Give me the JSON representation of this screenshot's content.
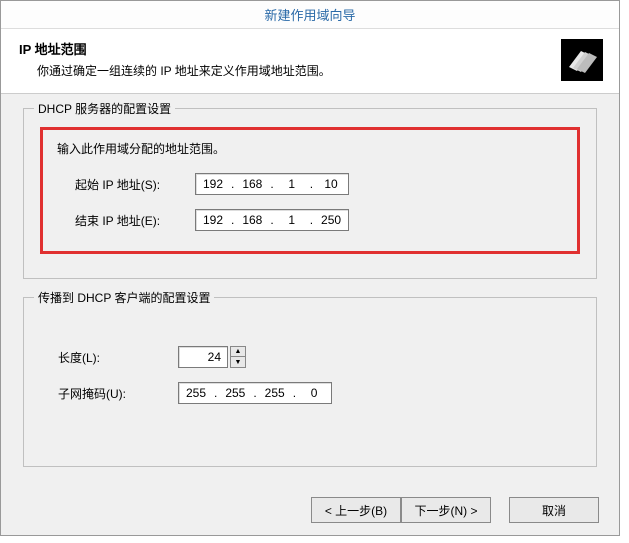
{
  "title": "新建作用域向导",
  "header": {
    "title": "IP 地址范围",
    "subtitle": "你通过确定一组连续的 IP 地址来定义作用域地址范围。"
  },
  "group1": {
    "legend": "DHCP 服务器的配置设置",
    "caption": "输入此作用域分配的地址范围。",
    "start_label": "起始 IP 地址(S):",
    "end_label": "结束 IP 地址(E):",
    "start_ip": {
      "o1": "192",
      "o2": "168",
      "o3": "1",
      "o4": "10"
    },
    "end_ip": {
      "o1": "192",
      "o2": "168",
      "o3": "1",
      "o4": "250"
    }
  },
  "group2": {
    "legend": "传播到 DHCP 客户端的配置设置",
    "length_label": "长度(L):",
    "length_value": "24",
    "mask_label": "子网掩码(U):",
    "mask": {
      "o1": "255",
      "o2": "255",
      "o3": "255",
      "o4": "0"
    }
  },
  "buttons": {
    "back": "< 上一步(B)",
    "next": "下一步(N) >",
    "cancel": "取消"
  }
}
